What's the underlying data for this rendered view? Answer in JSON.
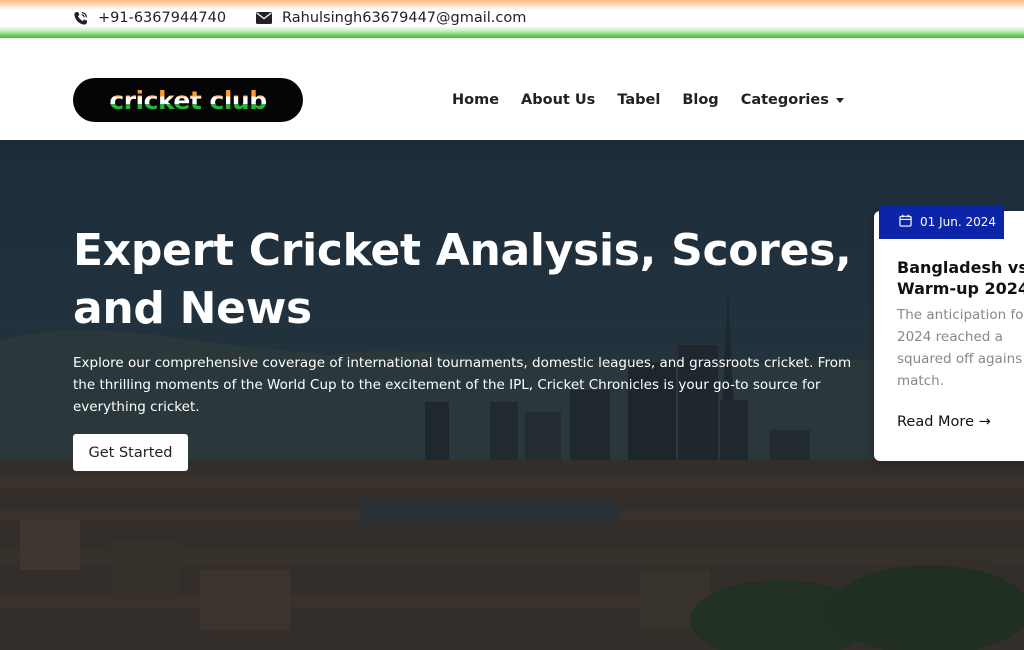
{
  "topbar": {
    "phone": "+91-6367944740",
    "email": "Rahulsingh63679447@gmail.com",
    "phone_icon": "phone-icon",
    "email_icon": "envelope-icon"
  },
  "navbar": {
    "logo_text": "cricket club",
    "links": [
      {
        "label": "Home"
      },
      {
        "label": "About Us"
      },
      {
        "label": "Tabel"
      },
      {
        "label": "Blog"
      },
      {
        "label": "Categories"
      }
    ]
  },
  "hero": {
    "title": "Expert Cricket Analysis, Scores, and News",
    "description": "Explore our comprehensive coverage of international tournaments, domestic leagues, and grassroots cricket. From the thrilling moments of the World Cup to the excitement of the IPL, Cricket Chronicles is your go-to source for everything cricket.",
    "cta_label": "Get Started"
  },
  "news_card": {
    "date": "01 Jun. 2024",
    "title": "Bangladesh vs\nWarm-up 2024",
    "text": "The anticipation fo\n2024 reached a\nsquared off agains\nmatch.",
    "read_more": "Read More →"
  },
  "colors": {
    "date_badge": "#0b24a8",
    "saffron": "#ff9a2e",
    "green": "#25b63a"
  }
}
